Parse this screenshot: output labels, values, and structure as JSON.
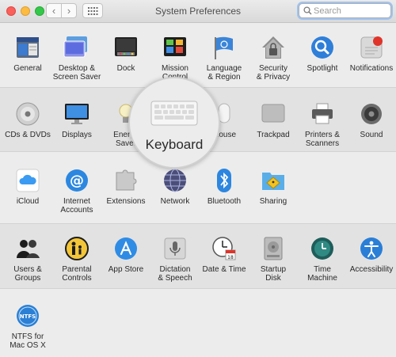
{
  "window": {
    "title": "System Preferences"
  },
  "toolbar": {
    "back": "‹",
    "forward": "›"
  },
  "search": {
    "placeholder": "Search",
    "value": ""
  },
  "rows": [
    [
      {
        "id": "general",
        "label": "General"
      },
      {
        "id": "desktop",
        "label": "Desktop &\nScreen Saver"
      },
      {
        "id": "dock",
        "label": "Dock"
      },
      {
        "id": "mission",
        "label": "Mission\nControl"
      },
      {
        "id": "language",
        "label": "Language\n& Region"
      },
      {
        "id": "security",
        "label": "Security\n& Privacy"
      },
      {
        "id": "spotlight",
        "label": "Spotlight"
      },
      {
        "id": "notifications",
        "label": "Notifications"
      }
    ],
    [
      {
        "id": "cds",
        "label": "CDs & DVDs"
      },
      {
        "id": "displays",
        "label": "Displays"
      },
      {
        "id": "energy",
        "label": "Energy\nSaver"
      },
      {
        "id": "keyboard",
        "label": ""
      },
      {
        "id": "mouse",
        "label": "Mouse"
      },
      {
        "id": "trackpad",
        "label": "Trackpad"
      },
      {
        "id": "printers",
        "label": "Printers &\nScanners"
      },
      {
        "id": "sound",
        "label": "Sound"
      }
    ],
    [
      {
        "id": "icloud",
        "label": "iCloud"
      },
      {
        "id": "internet",
        "label": "Internet\nAccounts"
      },
      {
        "id": "extensions",
        "label": "Extensions"
      },
      {
        "id": "network",
        "label": "Network"
      },
      {
        "id": "bluetooth",
        "label": "Bluetooth"
      },
      {
        "id": "sharing",
        "label": "Sharing"
      }
    ],
    [
      {
        "id": "users",
        "label": "Users &\nGroups"
      },
      {
        "id": "parental",
        "label": "Parental\nControls"
      },
      {
        "id": "appstore",
        "label": "App Store"
      },
      {
        "id": "dictation",
        "label": "Dictation\n& Speech"
      },
      {
        "id": "datetime",
        "label": "Date & Time"
      },
      {
        "id": "startup",
        "label": "Startup\nDisk"
      },
      {
        "id": "timemachine",
        "label": "Time\nMachine"
      },
      {
        "id": "accessibility",
        "label": "Accessibility"
      }
    ],
    [
      {
        "id": "ntfs",
        "label": "NTFS for\nMac OS X"
      }
    ]
  ],
  "magnifier": {
    "label": "Keyboard"
  },
  "icon_text": {
    "general": "File\nNew\nOp",
    "ntfs": "NTFS",
    "date_day": "18"
  }
}
